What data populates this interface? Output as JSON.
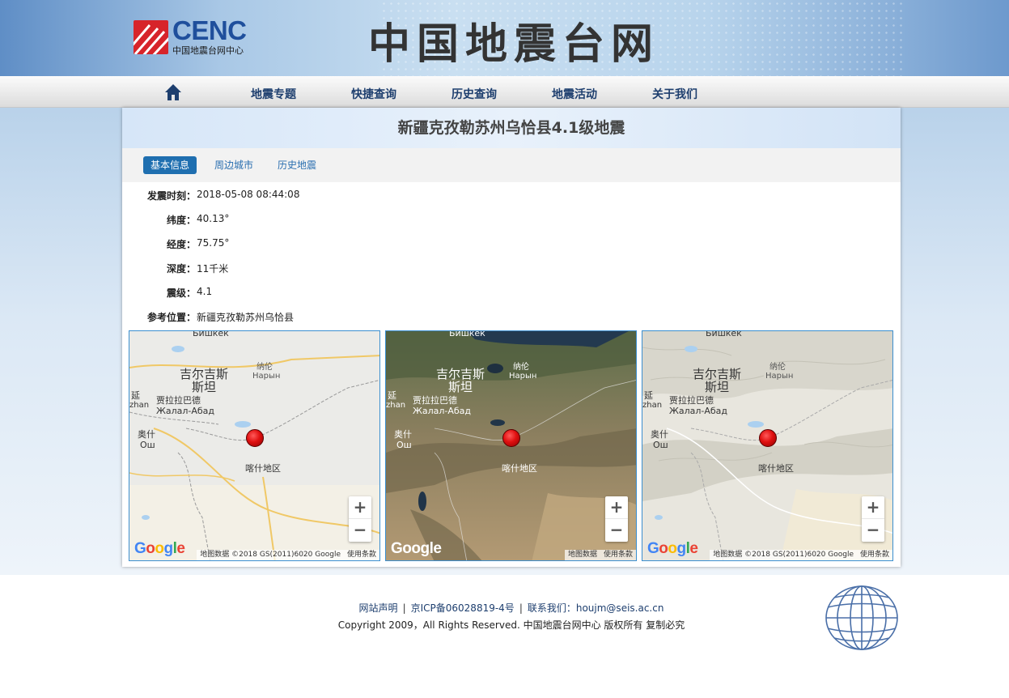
{
  "header": {
    "logo_text": "CENC",
    "logo_subtitle": "中国地震台网中心",
    "site_title": "中国地震台网"
  },
  "nav": {
    "home_icon": "home-icon",
    "items": [
      "地震专题",
      "快捷查询",
      "历史查询",
      "地震活动",
      "关于我们"
    ]
  },
  "event": {
    "title": "新疆克孜勒苏州乌恰县4.1级地震",
    "tabs": [
      "基本信息",
      "周边城市",
      "历史地震"
    ],
    "active_tab": "基本信息",
    "fields": [
      {
        "label": "发震时刻：",
        "value": "2018-05-08 08:44:08"
      },
      {
        "label": "纬度：",
        "value": "40.13°"
      },
      {
        "label": "经度：",
        "value": "75.75°"
      },
      {
        "label": "深度：",
        "value": "11千米"
      },
      {
        "label": "震级：",
        "value": "4.1"
      },
      {
        "label": "参考位置：",
        "value": "新疆克孜勒苏州乌恰县"
      }
    ]
  },
  "maps": {
    "labels": {
      "bishkek": "Бишкек",
      "kyrgyzstan": "吉尔吉斯\n斯坦",
      "naryn_cn": "纳伦",
      "naryn_ru": "Нарын",
      "jalal_cn": "贾拉拉巴德",
      "jalal_ru": "Жалал-Абад",
      "osh_cn": "奥什",
      "osh_ru": "Ош",
      "kashgar": "喀什地区",
      "edge_cn": "延",
      "edge_en": "zhan"
    },
    "zoom_in": "+",
    "zoom_out": "−",
    "google": "Google",
    "attribution_full": "地图数据 ©2018 GS(2011)6020 Google",
    "attribution_short": "地图数据",
    "terms": "使用条款",
    "types": [
      "roadmap",
      "satellite",
      "terrain"
    ]
  },
  "footer": {
    "links": [
      "网站声明",
      "京ICP备06028819-4号",
      "联系我们：houjm@seis.ac.cn"
    ],
    "separator": "|",
    "copyright": "Copyright 2009，All Rights Reserved. 中国地震台网中心 版权所有 复制必究"
  }
}
